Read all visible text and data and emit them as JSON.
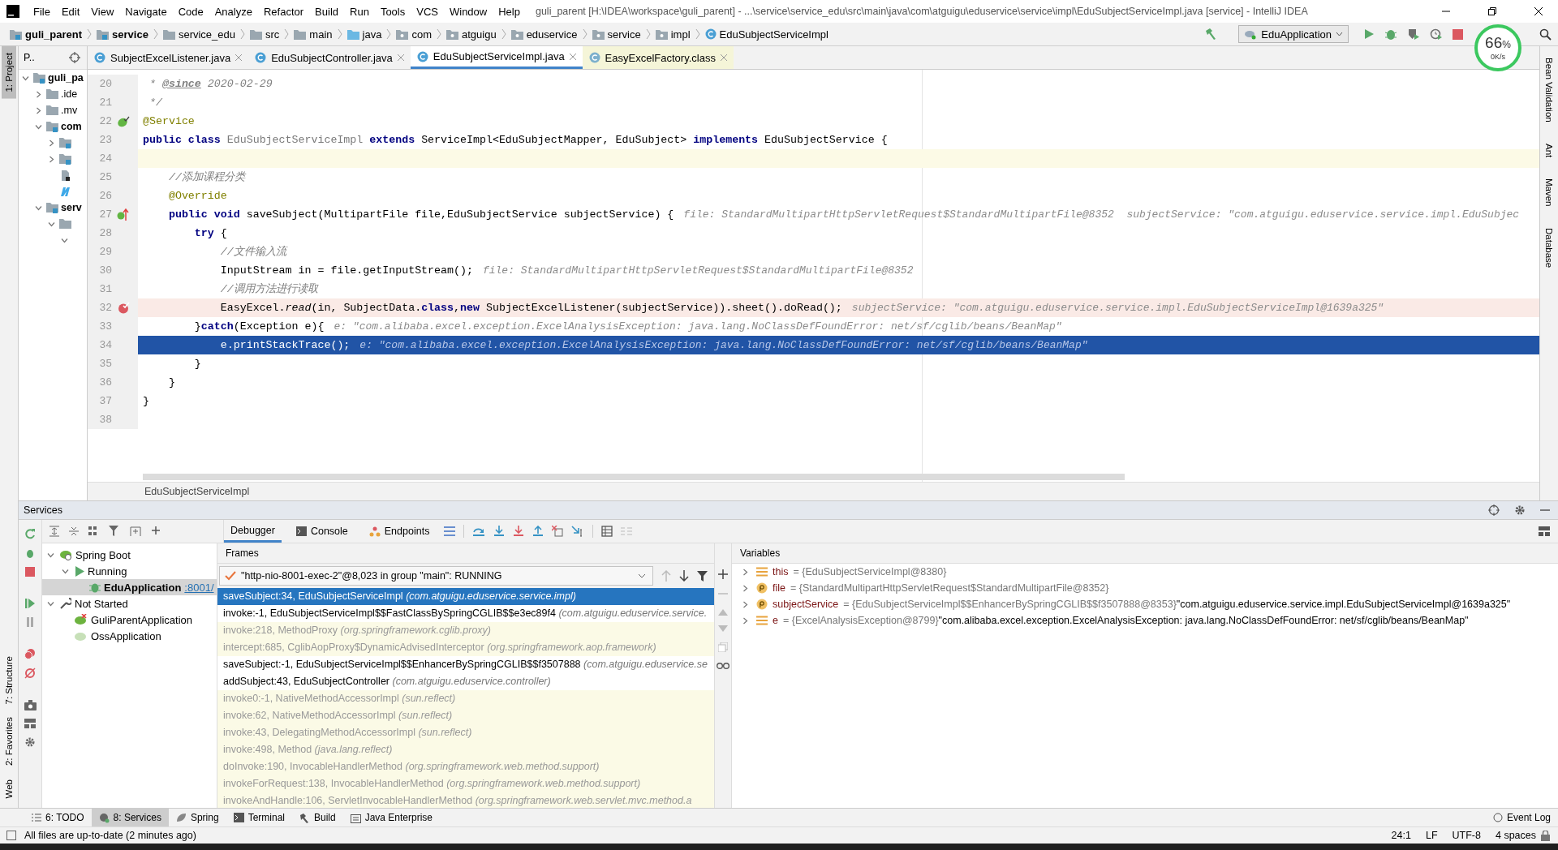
{
  "window": {
    "title": "guli_parent [H:\\IDEA\\workspace\\guli_parent] - ...\\service\\service_edu\\src\\main\\java\\com\\atguigu\\eduservice\\service\\impl\\EduSubjectServiceImpl.java [service] - IntelliJ IDEA"
  },
  "menu": [
    "File",
    "Edit",
    "View",
    "Navigate",
    "Code",
    "Analyze",
    "Refactor",
    "Build",
    "Run",
    "Tools",
    "VCS",
    "Window",
    "Help"
  ],
  "breadcrumbs": [
    {
      "label": "guli_parent",
      "kind": "module",
      "bold": true
    },
    {
      "label": "service",
      "kind": "module",
      "bold": true
    },
    {
      "label": "service_edu",
      "kind": "folder",
      "bold": false
    },
    {
      "label": "src",
      "kind": "folder",
      "bold": false
    },
    {
      "label": "main",
      "kind": "folder",
      "bold": false
    },
    {
      "label": "java",
      "kind": "source",
      "bold": false
    },
    {
      "label": "com",
      "kind": "package",
      "bold": false
    },
    {
      "label": "atguigu",
      "kind": "package",
      "bold": false
    },
    {
      "label": "eduservice",
      "kind": "package",
      "bold": false
    },
    {
      "label": "service",
      "kind": "package",
      "bold": false
    },
    {
      "label": "impl",
      "kind": "package",
      "bold": false
    },
    {
      "label": "EduSubjectServiceImpl",
      "kind": "class",
      "bold": false
    }
  ],
  "run_config": "EduApplication",
  "network_monitor": {
    "usage": "66",
    "unit": "%",
    "speed": "0K/s"
  },
  "left_strip": [
    {
      "label": "1: Project",
      "selected": true
    },
    {
      "label": "7: Structure",
      "selected": false
    },
    {
      "label": "2: Favorites",
      "selected": false
    },
    {
      "label": "Web",
      "selected": false
    }
  ],
  "right_strip": [
    "Bean Validation",
    "Ant",
    "Maven",
    "Database"
  ],
  "project": {
    "title": "P..",
    "tree": [
      {
        "label": "guli_pa",
        "kind": "module",
        "expanded": true,
        "children": [
          {
            "label": ".ide",
            "kind": "folder",
            "expanded": false
          },
          {
            "label": ".mv",
            "kind": "folder",
            "expanded": false
          },
          {
            "label": "com",
            "kind": "module",
            "expanded": true,
            "children": [
              {
                "kind": "module",
                "expanded": false
              },
              {
                "kind": "module",
                "expanded": false
              },
              {
                "kind": "file"
              },
              {
                "kind": "maven"
              }
            ]
          },
          {
            "label": "serv",
            "kind": "module",
            "expanded": true,
            "children": [
              {
                "kind": "folder",
                "expanded": true,
                "children": [
                  {
                    "kind": "none",
                    "expanded": true
                  }
                ]
              }
            ]
          }
        ]
      }
    ]
  },
  "tabs": [
    {
      "label": "SubjectExcelListener.java",
      "kind": "java",
      "selected": false
    },
    {
      "label": "EduSubjectController.java",
      "kind": "java",
      "selected": false
    },
    {
      "label": "EduSubjectServiceImpl.java",
      "kind": "java",
      "selected": true
    },
    {
      "label": "EasyExcelFactory.class",
      "kind": "class",
      "selected": false
    }
  ],
  "editor": {
    "lines": [
      {
        "number": "20",
        "kind": "plain",
        "caret_line": false,
        "breakpoint": false,
        "execution_point": false,
        "segments": [
          {
            "kind": "doc",
            "text": " * "
          },
          {
            "kind": "doctag",
            "text": "@since"
          },
          {
            "kind": "doc",
            "text": " 2020-02-29"
          }
        ]
      },
      {
        "number": "21",
        "kind": "plain",
        "caret_line": false,
        "breakpoint": false,
        "execution_point": false,
        "segments": [
          {
            "kind": "doc",
            "text": " */"
          }
        ]
      },
      {
        "number": "22",
        "kind": "bean",
        "caret_line": false,
        "breakpoint": false,
        "execution_point": false,
        "segments": [
          {
            "kind": "annotation",
            "text": "@Service"
          }
        ]
      },
      {
        "number": "23",
        "kind": "plain",
        "caret_line": false,
        "breakpoint": false,
        "execution_point": false,
        "segments": [
          {
            "kind": "keyword",
            "text": "public class "
          },
          {
            "kind": "muted",
            "text": "EduSubjectServiceImpl"
          },
          {
            "kind": "keyword",
            "text": " extends"
          },
          {
            "kind": "plain",
            "text": " ServiceImpl<EduSubjectMapper, EduSubject> "
          },
          {
            "kind": "keyword",
            "text": "implements"
          },
          {
            "kind": "plain",
            "text": " EduSubjectService {"
          }
        ]
      },
      {
        "number": "24",
        "kind": "plain",
        "caret_line": true,
        "breakpoint": false,
        "execution_point": false
      },
      {
        "number": "25",
        "kind": "plain",
        "caret_line": false,
        "breakpoint": false,
        "execution_point": false,
        "segments": [
          {
            "kind": "comment",
            "text": "    //添加课程分类"
          }
        ]
      },
      {
        "number": "26",
        "kind": "plain",
        "caret_line": false,
        "breakpoint": false,
        "execution_point": false,
        "segments": [
          {
            "kind": "annotation",
            "text": "    @Override"
          }
        ]
      },
      {
        "number": "27",
        "kind": "implements",
        "caret_line": false,
        "breakpoint": false,
        "execution_point": false,
        "segments": [
          {
            "kind": "keyword",
            "text": "    public void "
          },
          {
            "kind": "plain",
            "text": "saveSubject(MultipartFile file,EduSubjectService subjectService) {"
          }
        ],
        "hint": "file: StandardMultipartHttpServletRequest$StandardMultipartFile@8352  subjectService: \"com.atguigu.eduservice.service.impl.EduSubjec"
      },
      {
        "number": "28",
        "kind": "plain",
        "caret_line": false,
        "breakpoint": false,
        "execution_point": false,
        "segments": [
          {
            "kind": "keyword",
            "text": "        try"
          },
          {
            "kind": "plain",
            "text": " {"
          }
        ]
      },
      {
        "number": "29",
        "kind": "plain",
        "caret_line": false,
        "breakpoint": false,
        "execution_point": false,
        "segments": [
          {
            "kind": "comment",
            "text": "            //文件输入流"
          }
        ]
      },
      {
        "number": "30",
        "kind": "plain",
        "caret_line": false,
        "breakpoint": false,
        "execution_point": false,
        "segments": [
          {
            "kind": "plain",
            "text": "            InputStream in = file.getInputStream();"
          }
        ],
        "hint": "file: StandardMultipartHttpServletRequest$StandardMultipartFile@8352"
      },
      {
        "number": "31",
        "kind": "plain",
        "caret_line": false,
        "breakpoint": false,
        "execution_point": false,
        "segments": [
          {
            "kind": "comment",
            "text": "            //调用方法进行读取"
          }
        ]
      },
      {
        "number": "32",
        "kind": "plain",
        "caret_line": false,
        "breakpoint": true,
        "execution_point": false,
        "segments": [
          {
            "kind": "plain",
            "text": "            EasyExcel."
          },
          {
            "kind": "italic",
            "text": "read"
          },
          {
            "kind": "plain",
            "text": "(in, SubjectData."
          },
          {
            "kind": "keyword",
            "text": "class"
          },
          {
            "kind": "plain",
            "text": ","
          },
          {
            "kind": "keyword",
            "text": "new"
          },
          {
            "kind": "plain",
            "text": " SubjectExcelListener(subjectService)).sheet().doRead();"
          }
        ],
        "hint": "subjectService: \"com.atguigu.eduservice.service.impl.EduSubjectServiceImpl@1639a325\""
      },
      {
        "number": "33",
        "kind": "plain",
        "caret_line": false,
        "breakpoint": false,
        "execution_point": false,
        "segments": [
          {
            "kind": "plain",
            "text": "        }"
          },
          {
            "kind": "keyword",
            "text": "catch"
          },
          {
            "kind": "plain",
            "text": "(Exception e){"
          }
        ],
        "hint": "e: \"com.alibaba.excel.exception.ExcelAnalysisException: java.lang.NoClassDefFoundError: net/sf/cglib/beans/BeanMap\""
      },
      {
        "number": "34",
        "kind": "plain",
        "caret_line": false,
        "breakpoint": false,
        "execution_point": true,
        "segments": [
          {
            "kind": "plain",
            "text": "            e.printStackTrace();"
          }
        ],
        "hint": "e: \"com.alibaba.excel.exception.ExcelAnalysisException: java.lang.NoClassDefFoundError: net/sf/cglib/beans/BeanMap\""
      },
      {
        "number": "35",
        "kind": "plain",
        "caret_line": false,
        "breakpoint": false,
        "execution_point": false,
        "segments": [
          {
            "kind": "plain",
            "text": "        }"
          }
        ]
      },
      {
        "number": "36",
        "kind": "plain",
        "caret_line": false,
        "breakpoint": false,
        "execution_point": false,
        "segments": [
          {
            "kind": "plain",
            "text": "    }"
          }
        ]
      },
      {
        "number": "37",
        "kind": "plain",
        "caret_line": false,
        "breakpoint": false,
        "execution_point": false,
        "segments": [
          {
            "kind": "plain",
            "text": "}"
          }
        ]
      },
      {
        "number": "38",
        "kind": "plain",
        "caret_line": false,
        "breakpoint": false,
        "execution_point": false
      }
    ],
    "breadcrumb": "EduSubjectServiceImpl"
  },
  "services": {
    "title": "Services",
    "tree": [
      {
        "label": "Spring Boot",
        "kind": "springboot",
        "expanded": true,
        "selected": false,
        "children": [
          {
            "label": "Running",
            "kind": "running",
            "expanded": true,
            "selected": false,
            "children": [
              {
                "label": "EduApplication",
                "link": ":8001/",
                "kind": "debug-app",
                "selected": true
              }
            ]
          }
        ]
      },
      {
        "label": "Not Started",
        "kind": "wrench",
        "expanded": true,
        "selected": false,
        "children": [
          {
            "label": "GuliParentApplication",
            "kind": "error-app",
            "selected": false
          },
          {
            "label": "OssApplication",
            "kind": "idle-app",
            "selected": false
          }
        ]
      }
    ],
    "tabs": [
      {
        "label": "Debugger",
        "kind": "debugger",
        "selected": true
      },
      {
        "label": "Console",
        "kind": "console",
        "selected": false
      },
      {
        "label": "Endpoints",
        "kind": "endpoints",
        "selected": false
      }
    ],
    "frames_title": "Frames",
    "thread": "\"http-nio-8001-exec-2\"@8,023 in group \"main\": RUNNING",
    "frames": [
      {
        "method": "saveSubject:34, EduSubjectServiceImpl",
        "package": "(com.atguigu.eduservice.service.impl)",
        "library": false,
        "selected": true
      },
      {
        "method": "invoke:-1, EduSubjectServiceImpl$$FastClassBySpringCGLIB$$e3ec89f4",
        "package": "(com.atguigu.eduservice.service.",
        "library": false,
        "selected": false
      },
      {
        "method": "invoke:218, MethodProxy",
        "package": "(org.springframework.cglib.proxy)",
        "library": true,
        "selected": false
      },
      {
        "method": "intercept:685, CglibAopProxy$DynamicAdvisedInterceptor",
        "package": "(org.springframework.aop.framework)",
        "library": true,
        "selected": false
      },
      {
        "method": "saveSubject:-1, EduSubjectServiceImpl$$EnhancerBySpringCGLIB$$f3507888",
        "package": "(com.atguigu.eduservice.se",
        "library": false,
        "selected": false
      },
      {
        "method": "addSubject:43, EduSubjectController",
        "package": "(com.atguigu.eduservice.controller)",
        "library": false,
        "selected": false
      },
      {
        "method": "invoke0:-1, NativeMethodAccessorImpl",
        "package": "(sun.reflect)",
        "library": true,
        "selected": false
      },
      {
        "method": "invoke:62, NativeMethodAccessorImpl",
        "package": "(sun.reflect)",
        "library": true,
        "selected": false
      },
      {
        "method": "invoke:43, DelegatingMethodAccessorImpl",
        "package": "(sun.reflect)",
        "library": true,
        "selected": false
      },
      {
        "method": "invoke:498, Method",
        "package": "(java.lang.reflect)",
        "library": true,
        "selected": false
      },
      {
        "method": "doInvoke:190, InvocableHandlerMethod",
        "package": "(org.springframework.web.method.support)",
        "library": true,
        "selected": false
      },
      {
        "method": "invokeForRequest:138, InvocableHandlerMethod",
        "package": "(org.springframework.web.method.support)",
        "library": true,
        "selected": false
      },
      {
        "method": "invokeAndHandle:106, ServletInvocableHandlerMethod",
        "package": "(org.springframework.web.servlet.mvc.method.a",
        "library": true,
        "selected": false
      }
    ],
    "variables_title": "Variables",
    "variables": [
      {
        "name": "this",
        "kind": "field",
        "value": "= {EduSubjectServiceImpl@8380}"
      },
      {
        "name": "file",
        "kind": "param",
        "value": "= {StandardMultipartHttpServletRequest$StandardMultipartFile@8352}"
      },
      {
        "name": "subjectService",
        "kind": "param",
        "value": "= {EduSubjectServiceImpl$$EnhancerBySpringCGLIB$$f3507888@8353}",
        "string": "\"com.atguigu.eduservice.service.impl.EduSubjectServiceImpl@1639a325\""
      },
      {
        "name": "e",
        "kind": "field",
        "value": "= {ExcelAnalysisException@8799}",
        "string": "\"com.alibaba.excel.exception.ExcelAnalysisException: java.lang.NoClassDefFoundError: net/sf/cglib/beans/BeanMap\""
      }
    ]
  },
  "tool_windows": [
    {
      "label": "6: TODO",
      "kind": "todo",
      "selected": false
    },
    {
      "label": "8: Services",
      "kind": "services",
      "selected": true
    },
    {
      "label": "Spring",
      "kind": "spring",
      "selected": false
    },
    {
      "label": "Terminal",
      "kind": "terminal",
      "selected": false
    },
    {
      "label": "Build",
      "kind": "build",
      "selected": false
    },
    {
      "label": "Java Enterprise",
      "kind": "enterprise",
      "selected": false
    }
  ],
  "event_log": "Event Log",
  "status_bar": {
    "message": "All files are up-to-date (2 minutes ago)",
    "position": "24:1",
    "line_separator": "LF",
    "encoding": "UTF-8",
    "indent": "4 spaces"
  }
}
